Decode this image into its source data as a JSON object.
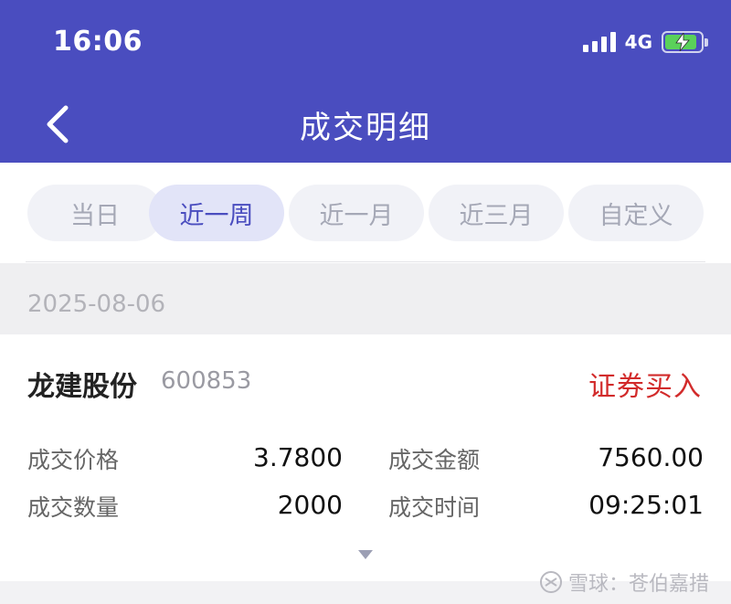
{
  "status_bar": {
    "time": "16:06",
    "network": "4G"
  },
  "nav": {
    "title": "成交明细"
  },
  "filters": [
    {
      "label": "当日",
      "active": false
    },
    {
      "label": "近一周",
      "active": true
    },
    {
      "label": "近一月",
      "active": false
    },
    {
      "label": "近三月",
      "active": false
    },
    {
      "label": "自定义",
      "active": false
    }
  ],
  "date": "2025-08-06",
  "trade": {
    "stock_name": "龙建股份",
    "stock_code": "600853",
    "type": "证券买入",
    "price_label": "成交价格",
    "price": "3.7800",
    "amount_label": "成交金额",
    "amount": "7560.00",
    "quantity_label": "成交数量",
    "quantity": "2000",
    "time_label": "成交时间",
    "time": "09:25:01"
  },
  "watermark": {
    "text": "雪球：苍伯嘉措"
  },
  "colors": {
    "header": "#4a4dbf",
    "active_tab_bg": "#e2e4f8",
    "buy_red": "#d22b2b",
    "battery_green": "#5ad15a"
  },
  "icons": {
    "back": "chevron-left-icon",
    "expand": "triangle-down-icon"
  }
}
